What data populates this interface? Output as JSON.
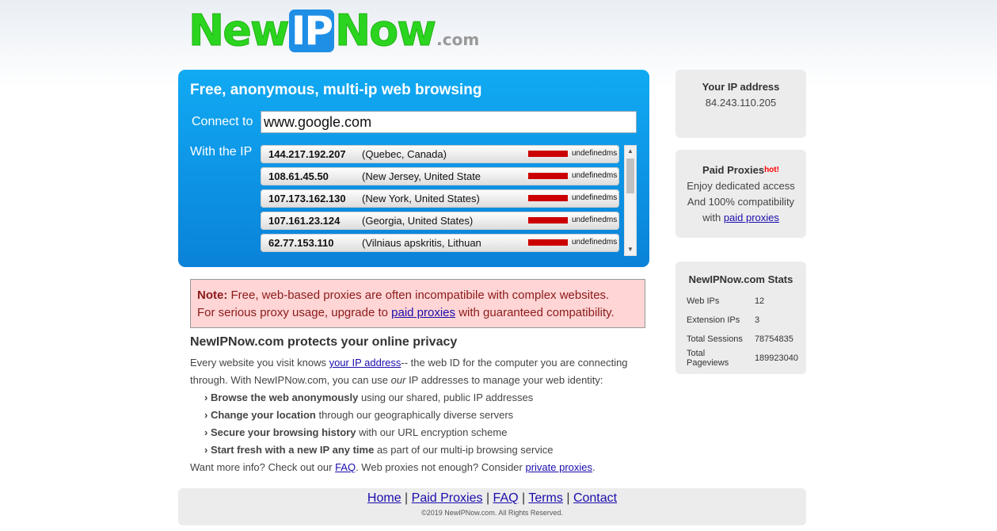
{
  "logo": {
    "part1": "New",
    "part2": "IP",
    "part3": "Now",
    "suffix": ".com"
  },
  "main": {
    "title": "Free, anonymous, multi-ip web browsing",
    "connect_label": "Connect to",
    "url_value": "www.google.com",
    "with_label": "With the IP",
    "proxies": [
      {
        "ip": "144.217.192.207",
        "location": "(Quebec, Canada)",
        "latency": "undefinedms"
      },
      {
        "ip": "108.61.45.50",
        "location": "(New Jersey, United States)",
        "latency": "undefinedms"
      },
      {
        "ip": "107.173.162.130",
        "location": "(New York, United States)",
        "latency": "undefinedms"
      },
      {
        "ip": "107.161.23.124",
        "location": "(Georgia, United States)",
        "latency": "undefinedms"
      },
      {
        "ip": "62.77.153.110",
        "location": "(Vilniaus apskritis, Lithuania)",
        "latency": "undefinedms"
      }
    ],
    "latency_bar_color": "#cc0000"
  },
  "note": {
    "label": "Note:",
    "line1": "Free, web-based proxies are often incompatibile with complex websites.",
    "line2_pre": "For serious proxy usage, upgrade to",
    "line2_link": "paid proxies",
    "line2_post": "with guaranteed compatibility."
  },
  "privacy": {
    "heading": "NewIPNow.com protects your online privacy",
    "intro_pre": "Every website you visit knows",
    "intro_link": "your IP address",
    "intro_mid": "-- the web ID for the computer you are connecting through. With NewIPNow.com, you can use",
    "intro_em": "our",
    "intro_post": "IP addresses to manage your web identity:",
    "bullets": [
      {
        "bold": "Browse the web anonymously",
        "rest": "using our shared, public IP addresses"
      },
      {
        "bold": "Change your location",
        "rest": "through our geographically diverse servers"
      },
      {
        "bold": "Secure your browsing history",
        "rest": "with our URL encryption scheme"
      },
      {
        "bold": "Start fresh with a new IP any time",
        "rest": "as part of our multi-ip browsing service"
      }
    ],
    "more_pre": "Want more info? Check out our",
    "faq_link": "FAQ",
    "more_mid": ". Web proxies not enough? Consider",
    "private_link": "private proxies",
    "more_post": "."
  },
  "sidebar": {
    "your_ip_title": "Your IP address",
    "your_ip_value": "84.243.110.205",
    "paid_title": "Paid Proxies",
    "paid_hot": "hot!",
    "paid_line1": "Enjoy dedicated access",
    "paid_line2": "And 100% compatibility",
    "paid_line3_pre": "with",
    "paid_link": "paid proxies",
    "stats_title": "NewIPNow.com Stats",
    "stats": [
      {
        "label": "Web IPs",
        "value": "12"
      },
      {
        "label": "Extension IPs",
        "value": "3"
      },
      {
        "label": "Total Sessions",
        "value": "78754835"
      },
      {
        "label": "Total Pageviews",
        "value": "189923040"
      }
    ]
  },
  "footer": {
    "links": [
      "Home",
      "Paid Proxies",
      "FAQ",
      "Terms",
      "Contact"
    ],
    "separator": "|",
    "copyright": "©2019 NewIPNow.com. All Rights Reserved."
  }
}
